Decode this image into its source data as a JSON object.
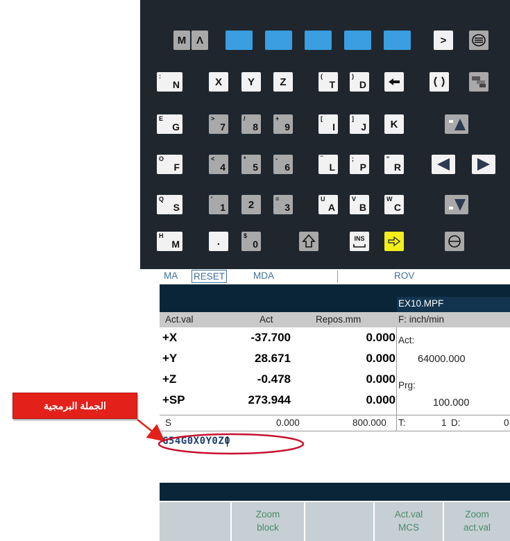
{
  "keypad": {
    "rows": [
      [
        {
          "id": "m",
          "main": "M",
          "style": "gray",
          "w": 24
        },
        {
          "id": "caret",
          "main": "Λ",
          "style": "gray",
          "w": 24
        },
        {
          "id": "blue1",
          "main": "",
          "style": "blue",
          "w": 39
        },
        {
          "id": "blue2",
          "main": "",
          "style": "blue",
          "w": 39
        },
        {
          "id": "blue3",
          "main": "",
          "style": "blue",
          "w": 39
        },
        {
          "id": "blue4",
          "main": "",
          "style": "blue",
          "w": 39
        },
        {
          "id": "blue5",
          "main": "",
          "style": "blue",
          "w": 39
        },
        {
          "id": "gt",
          "main": ">",
          "style": "light",
          "w": 28
        },
        {
          "id": "menu",
          "main": "",
          "style": "gray",
          "w": 28,
          "icon": "menu-icon"
        }
      ],
      [
        {
          "id": "n",
          "main": "N",
          "sub": ":",
          "style": "light",
          "w": 37
        },
        {
          "id": "x",
          "main": "X",
          "style": "light",
          "w": 28
        },
        {
          "id": "y",
          "main": "Y",
          "style": "light",
          "w": 28
        },
        {
          "id": "z",
          "main": "Z",
          "style": "light",
          "w": 28
        },
        {
          "id": "t",
          "main": "T",
          "sub": "(",
          "style": "light",
          "w": 28
        },
        {
          "id": "d",
          "main": "D",
          "sub": ")",
          "style": "light",
          "w": 28
        },
        {
          "id": "backspace",
          "main": "",
          "style": "light",
          "w": 28,
          "icon": "backspace-icon"
        },
        {
          "id": "channel",
          "main": "",
          "style": "light",
          "w": 28,
          "icon": "channel-icon"
        },
        {
          "id": "window",
          "main": "",
          "style": "gray",
          "w": 28,
          "icon": "window-icon"
        }
      ],
      [
        {
          "id": "g",
          "main": "G",
          "sub": "E",
          "style": "light",
          "w": 37
        },
        {
          "id": "7",
          "main": "7",
          "sub": ">",
          "style": "gray",
          "w": 28
        },
        {
          "id": "8",
          "main": "8",
          "sub": "/",
          "style": "gray",
          "w": 28
        },
        {
          "id": "9",
          "main": "9",
          "sub": "+",
          "style": "gray",
          "w": 28
        },
        {
          "id": "i",
          "main": "I",
          "sub": "[",
          "style": "light",
          "w": 28
        },
        {
          "id": "j",
          "main": "J",
          "sub": "]",
          "style": "light",
          "w": 28
        },
        {
          "id": "k",
          "main": "K",
          "style": "light",
          "w": 28
        },
        {
          "id": "pageup",
          "main": "",
          "style": "gray",
          "w": 34,
          "icon": "page-up-icon"
        }
      ],
      [
        {
          "id": "f",
          "main": "F",
          "sub": "O",
          "style": "light",
          "w": 37
        },
        {
          "id": "4",
          "main": "4",
          "sub": "<",
          "style": "gray",
          "w": 28
        },
        {
          "id": "5",
          "main": "5",
          "sub": "*",
          "style": "gray",
          "w": 28
        },
        {
          "id": "6",
          "main": "6",
          "sub": "-",
          "style": "gray",
          "w": 28
        },
        {
          "id": "l",
          "main": "L",
          "sub": "‾",
          "style": "light",
          "w": 28
        },
        {
          "id": "p",
          "main": "P",
          "sub": ";",
          "style": "light",
          "w": 28
        },
        {
          "id": "r",
          "main": "R",
          "sub": "\"",
          "style": "light",
          "w": 28
        },
        {
          "id": "left",
          "main": "",
          "style": "light",
          "w": 34,
          "icon": "arrow-left-icon"
        },
        {
          "id": "right",
          "main": "",
          "style": "light",
          "w": 34,
          "icon": "arrow-right-icon"
        }
      ],
      [
        {
          "id": "s",
          "main": "S",
          "sub": "Q",
          "style": "light",
          "w": 37
        },
        {
          "id": "1",
          "main": "1",
          "sub": "'",
          "style": "gray",
          "w": 28
        },
        {
          "id": "2",
          "main": "2",
          "style": "gray",
          "w": 28
        },
        {
          "id": "3",
          "main": "3",
          "sub": "=",
          "style": "gray",
          "w": 28
        },
        {
          "id": "a",
          "main": "A",
          "sub": "U",
          "style": "light",
          "w": 28
        },
        {
          "id": "b",
          "main": "B",
          "sub": "V",
          "style": "light",
          "w": 28
        },
        {
          "id": "c",
          "main": "C",
          "sub": "W",
          "style": "light",
          "w": 28
        },
        {
          "id": "pagedown",
          "main": "",
          "style": "gray",
          "w": 34,
          "icon": "page-down-icon"
        }
      ],
      [
        {
          "id": "hm",
          "main": "M",
          "sub": "H",
          "style": "light",
          "w": 37
        },
        {
          "id": "dot",
          "main": ".",
          "style": "light",
          "w": 28
        },
        {
          "id": "0",
          "main": "0",
          "sub": "$",
          "style": "gray",
          "w": 28
        },
        {
          "id": "shift",
          "main": "",
          "style": "gray",
          "w": 28,
          "icon": "shift-icon"
        },
        {
          "id": "ins",
          "main": "INS",
          "style": "light",
          "w": 28,
          "icon": "insert-icon"
        },
        {
          "id": "input",
          "main": "",
          "style": "yellow",
          "w": 28,
          "icon": "input-arrow-icon"
        },
        {
          "id": "select",
          "main": "",
          "style": "gray",
          "w": 28,
          "icon": "select-icon"
        }
      ]
    ]
  },
  "status": {
    "ma": "MA",
    "reset": "RESET",
    "mda": "MDA",
    "rov": "ROV"
  },
  "program_name": "EX10.MPF",
  "axes_header": {
    "col1": "Act.val",
    "col2": "Act",
    "col3": "Repos.mm",
    "feed_label": "F: inch/min"
  },
  "axes": [
    {
      "axis": "+X",
      "act": "-37.700",
      "repos": "0.000"
    },
    {
      "axis": "+Y",
      "act": "28.671",
      "repos": "0.000"
    },
    {
      "axis": "+Z",
      "act": "-0.478",
      "repos": "0.000"
    },
    {
      "axis": "+SP",
      "act": "273.944",
      "repos": "0.000"
    }
  ],
  "feed": {
    "act_label": "Act:",
    "act_value": "64000.000",
    "prg_label": "Prg:",
    "prg_value": "100.000"
  },
  "spindle_row": {
    "label": "S",
    "value1": "0.000",
    "value2": "800.000",
    "tool_label": "T:",
    "tool_value": "1",
    "d_label": "D:",
    "d_value": "0"
  },
  "mda_input": {
    "text": "G54G0X0Y0Z0"
  },
  "softkeys": [
    {
      "label": ""
    },
    {
      "label": "Zoom\nblock"
    },
    {
      "label": ""
    },
    {
      "label": "Act.val\nMCS"
    },
    {
      "label": "Zoom\nact.val"
    }
  ],
  "annotation": {
    "text": "الجملة البرمجية"
  },
  "colors": {
    "keypad_bg": "#1f262e",
    "key_blue": "#3a9ee0",
    "key_yellow": "#f3ef1a",
    "annotation_red": "#e32019",
    "ellipse_red": "#c8102e",
    "input_text": "#1c3f6e"
  }
}
